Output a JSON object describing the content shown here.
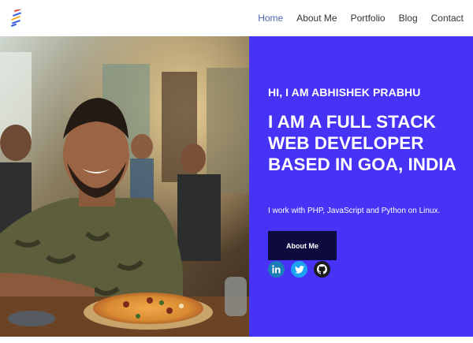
{
  "colors": {
    "hero_background": "#4633f5",
    "button_background": "#0d0a3d",
    "nav_active": "#4a67ad",
    "nav_text": "#333333",
    "linkedin": "#1a7db8",
    "twitter": "#1da1f2",
    "github": "#1b1b1b"
  },
  "header": {
    "logo_icon": "stripes-logo-icon",
    "nav": [
      {
        "label": "Home",
        "active": true
      },
      {
        "label": "About Me",
        "active": false
      },
      {
        "label": "Portfolio",
        "active": false
      },
      {
        "label": "Blog",
        "active": false
      },
      {
        "label": "Contact",
        "active": false
      }
    ]
  },
  "hero": {
    "greeting": "HI, I AM ABHISHEK PRABHU",
    "headline": "I AM A FULL STACK WEB DEVELOPER BASED IN GOA, INDIA",
    "subtitle": "I work with PHP, JavaScript and Python on Linux.",
    "cta_label": "About Me",
    "socials": [
      {
        "name": "linkedin",
        "icon": "linkedin-icon"
      },
      {
        "name": "twitter",
        "icon": "twitter-icon"
      },
      {
        "name": "github",
        "icon": "github-icon"
      }
    ]
  },
  "photo": {
    "subject": "profile-photo"
  }
}
